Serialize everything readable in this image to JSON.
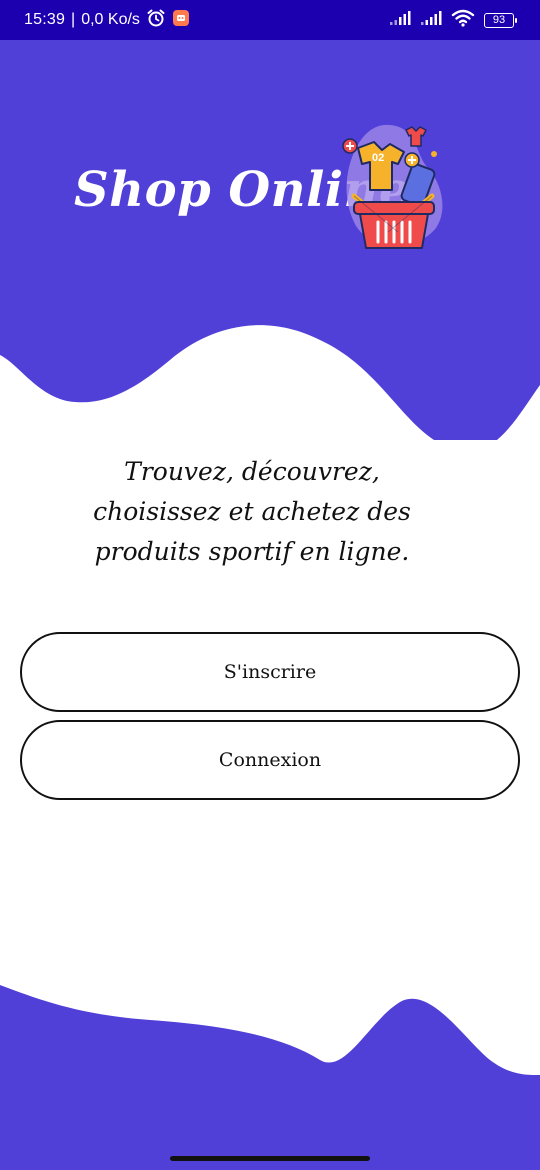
{
  "status_bar": {
    "time": "15:39",
    "separator": "|",
    "network_speed": "0,0 Ko/s",
    "battery_level": "93",
    "background_color": "#1c00b0",
    "icons": [
      "alarm-icon",
      "app-notification-icon",
      "signal-icon",
      "signal-icon",
      "wifi-icon",
      "battery-icon"
    ]
  },
  "header": {
    "app_title": "Shop Online",
    "logo_icon": "shopping-basket-icon",
    "logo_badge_text": "02",
    "background_color": "#5040d8"
  },
  "main": {
    "tagline_lines": [
      "Trouvez, découvrez,",
      "choisissez et achetez des",
      "produits sportif en ligne."
    ]
  },
  "buttons": {
    "register_label": "S'inscrire",
    "login_label": "Connexion"
  }
}
